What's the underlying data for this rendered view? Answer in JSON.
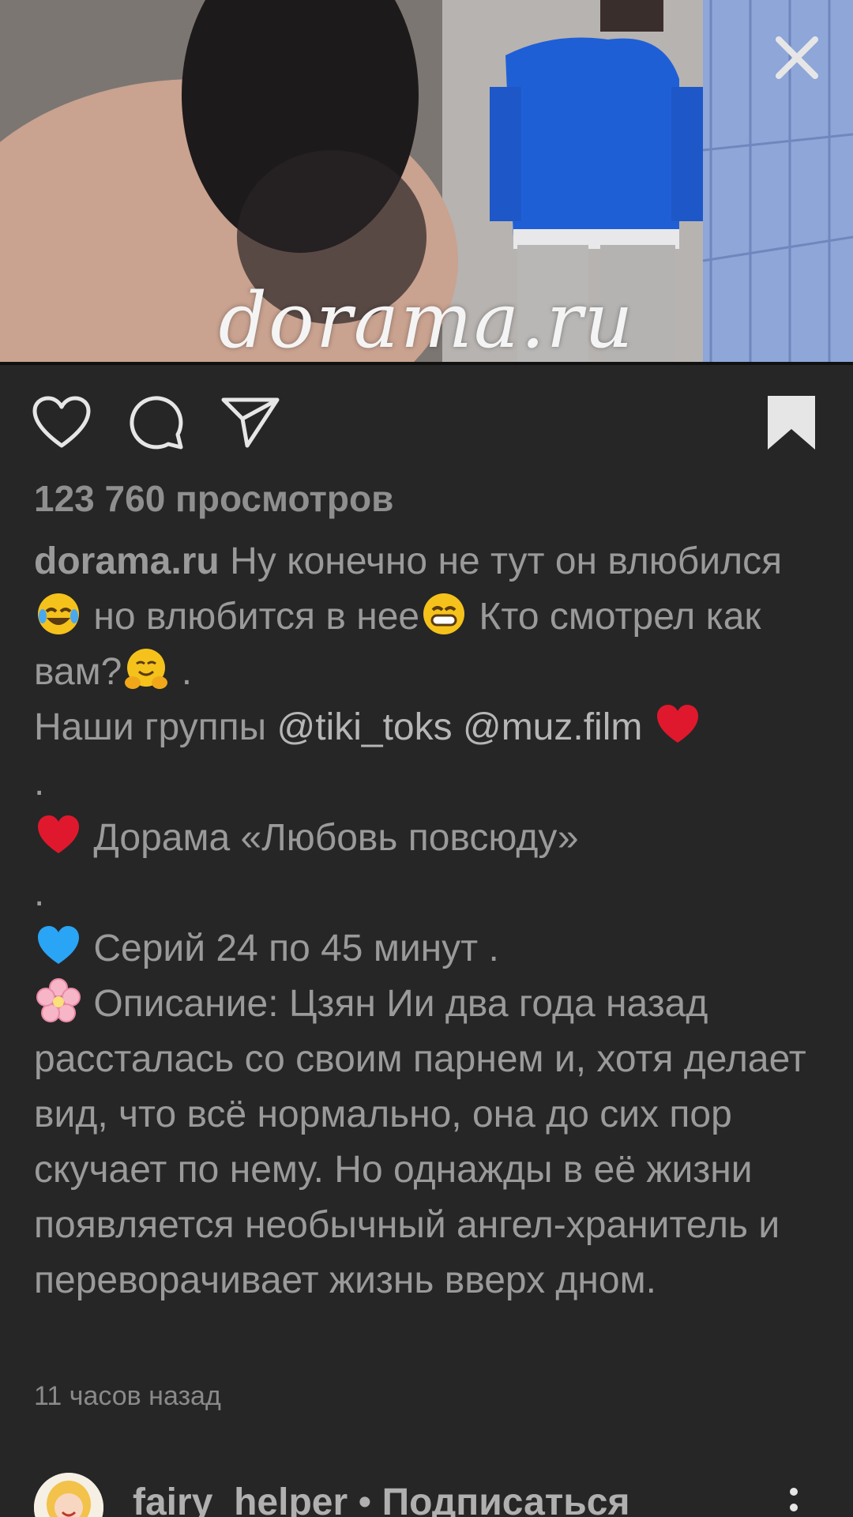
{
  "media": {
    "watermark": "dorama.ru",
    "close_icon": "close-icon"
  },
  "actions": {
    "like_icon": "heart-icon",
    "comment_icon": "comment-icon",
    "share_icon": "send-icon",
    "save_icon": "bookmark-icon"
  },
  "views": "123 760 просмотров",
  "caption": {
    "username": "dorama.ru",
    "line1": " Ну конечно не тут он влюбился",
    "line1b": " но влюбится в нее",
    "line1c": " Кто смотрел как вам?",
    "line1d": " .",
    "line2_prefix": "Наши группы ",
    "mention1": "@tiki_toks",
    "mention2": "@muz.film",
    "dot1": ".",
    "drama_title": " Дорама «Любовь повсюду»",
    "dot2": ".",
    "episodes": " Серий 24 по 45 минут .",
    "description": " Описание: Цзян Ии два года назад рассталась со своим парнем и, хотя делает вид, что всё нормально, она до сих пор скучает по нему. Но однажды в её жизни появляется необычный ангел-хранитель и переворачивает жизнь вверх дном."
  },
  "timestamp": "11 часов назад",
  "next_post": {
    "username": "fairy_helper",
    "separator": " • ",
    "follow_label": "Подписаться",
    "more_icon": "more-vertical-icon"
  },
  "colors": {
    "background": "#262626",
    "text": "#9a9a9a",
    "heart_emoji": "#e0182d",
    "blue_heart": "#2aa4f4"
  }
}
